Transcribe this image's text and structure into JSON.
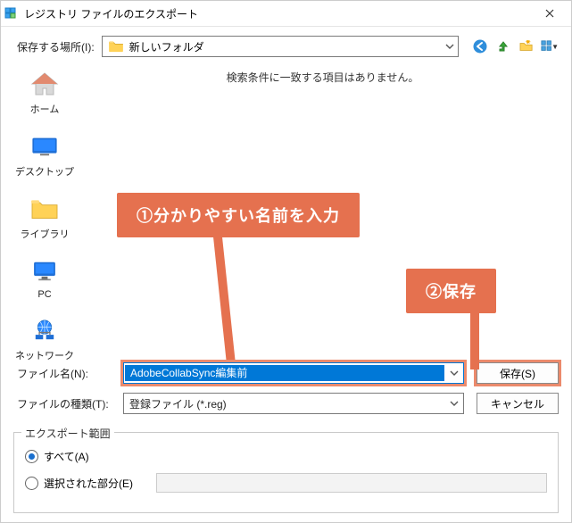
{
  "window": {
    "title": "レジストリ ファイルのエクスポート"
  },
  "location": {
    "label": "保存する場所(I):",
    "folder_name": "新しいフォルダ"
  },
  "places": {
    "home": "ホーム",
    "desktop": "デスクトップ",
    "libraries": "ライブラリ",
    "pc": "PC",
    "network": "ネットワーク"
  },
  "pane": {
    "empty": "検索条件に一致する項目はありません。"
  },
  "annotations": {
    "step1": "①分かりやすい名前を入力",
    "step2": "②保存"
  },
  "form": {
    "filename_label": "ファイル名(N):",
    "filename_value": "AdobeCollabSync編集前",
    "filetype_label": "ファイルの種類(T):",
    "filetype_value": "登録ファイル (*.reg)",
    "save_btn": "保存(S)",
    "cancel_btn": "キャンセル"
  },
  "scope": {
    "legend": "エクスポート範囲",
    "all": "すべて(A)",
    "selected": "選択された部分(E)"
  }
}
